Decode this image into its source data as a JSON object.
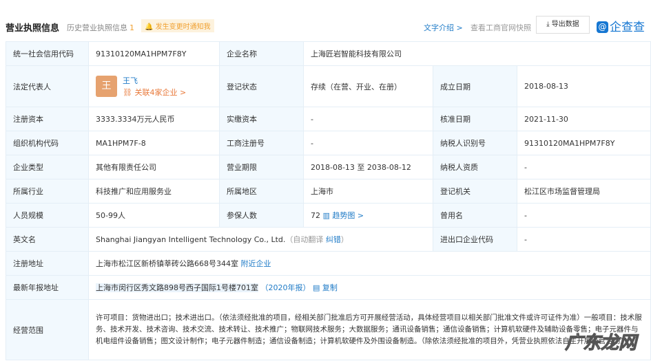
{
  "header": {
    "title": "营业执照信息",
    "history_label": "历史营业执照信息",
    "history_count": "1",
    "notify": "发生变更时通知我",
    "intro": "文字介绍 >",
    "snapshot": "查看工商官网快照",
    "export": "导出数据",
    "logo": "企查查"
  },
  "rows": {
    "credit_code_label": "统一社会信用代码",
    "credit_code": "91310120MA1HPM7F8Y",
    "name_label": "企业名称",
    "name": "上海匠岩智能科技有限公司",
    "rep_label": "法定代表人",
    "rep_avatar": "王",
    "rep_name": "王飞",
    "rep_related": "关联4家企业 >",
    "status_label": "登记状态",
    "status": "存续（在营、开业、在册）",
    "founded_label": "成立日期",
    "founded": "2018-08-13",
    "capital_label": "注册资本",
    "capital": "3333.3334万元人民币",
    "paid_label": "实缴资本",
    "paid": "-",
    "approved_label": "核准日期",
    "approved": "2021-11-30",
    "org_label": "组织机构代码",
    "org": "MA1HPM7F-8",
    "reg_no_label": "工商注册号",
    "reg_no": "-",
    "taxid_label": "纳税人识别号",
    "taxid": "91310120MA1HPM7F8Y",
    "type_label": "企业类型",
    "type": "其他有限责任公司",
    "term_label": "营业期限",
    "term": "2018-08-13 至 2038-08-12",
    "taxq_label": "纳税人资质",
    "taxq": "-",
    "industry_label": "所属行业",
    "industry": "科技推广和应用服务业",
    "region_label": "所属地区",
    "region": "上海市",
    "authority_label": "登记机关",
    "authority": "松江区市场监督管理局",
    "staff_label": "人员规模",
    "staff": "50-99人",
    "insured_label": "参保人数",
    "insured": "72",
    "trend": "趋势图 >",
    "former_label": "曾用名",
    "former": "-",
    "en_label": "英文名",
    "en": "Shanghai Jiangyan Intelligent Technology Co., Ltd.",
    "auto_translate": "（自动翻译",
    "correct": "纠错",
    "close_paren": "）",
    "ie_label": "进出口企业代码",
    "ie": "-",
    "addr_label": "注册地址",
    "addr": "上海市松江区新桥镇莘砖公路668号344室",
    "nearby": "附近企业",
    "annual_label": "最新年报地址",
    "annual": "上海市闵行区秀文路898号西子国际1号楼701室",
    "annual_year": "（2020年报）",
    "copy": "复制",
    "scope_label": "经营范围",
    "scope": "许可项目：货物进出口；技术进出口。（依法须经批准的项目，经相关部门批准后方可开展经营活动，具体经营项目以相关部门批准文件或许可证件为准）一般项目：技术服务、技术开发、技术咨询、技术交流、技术转让、技术推广；物联网技术服务；大数据服务；通讯设备销售；通信设备销售；计算机软硬件及辅助设备零售；电子元器件与机电组件设备销售；图文设计制作；电子元器件制造；通信设备制造；计算机软硬件及外围设备制造。（除依法须经批准的项目外，凭营业执照依法自主开展经营活动）"
  },
  "watermark": "广东龙网"
}
